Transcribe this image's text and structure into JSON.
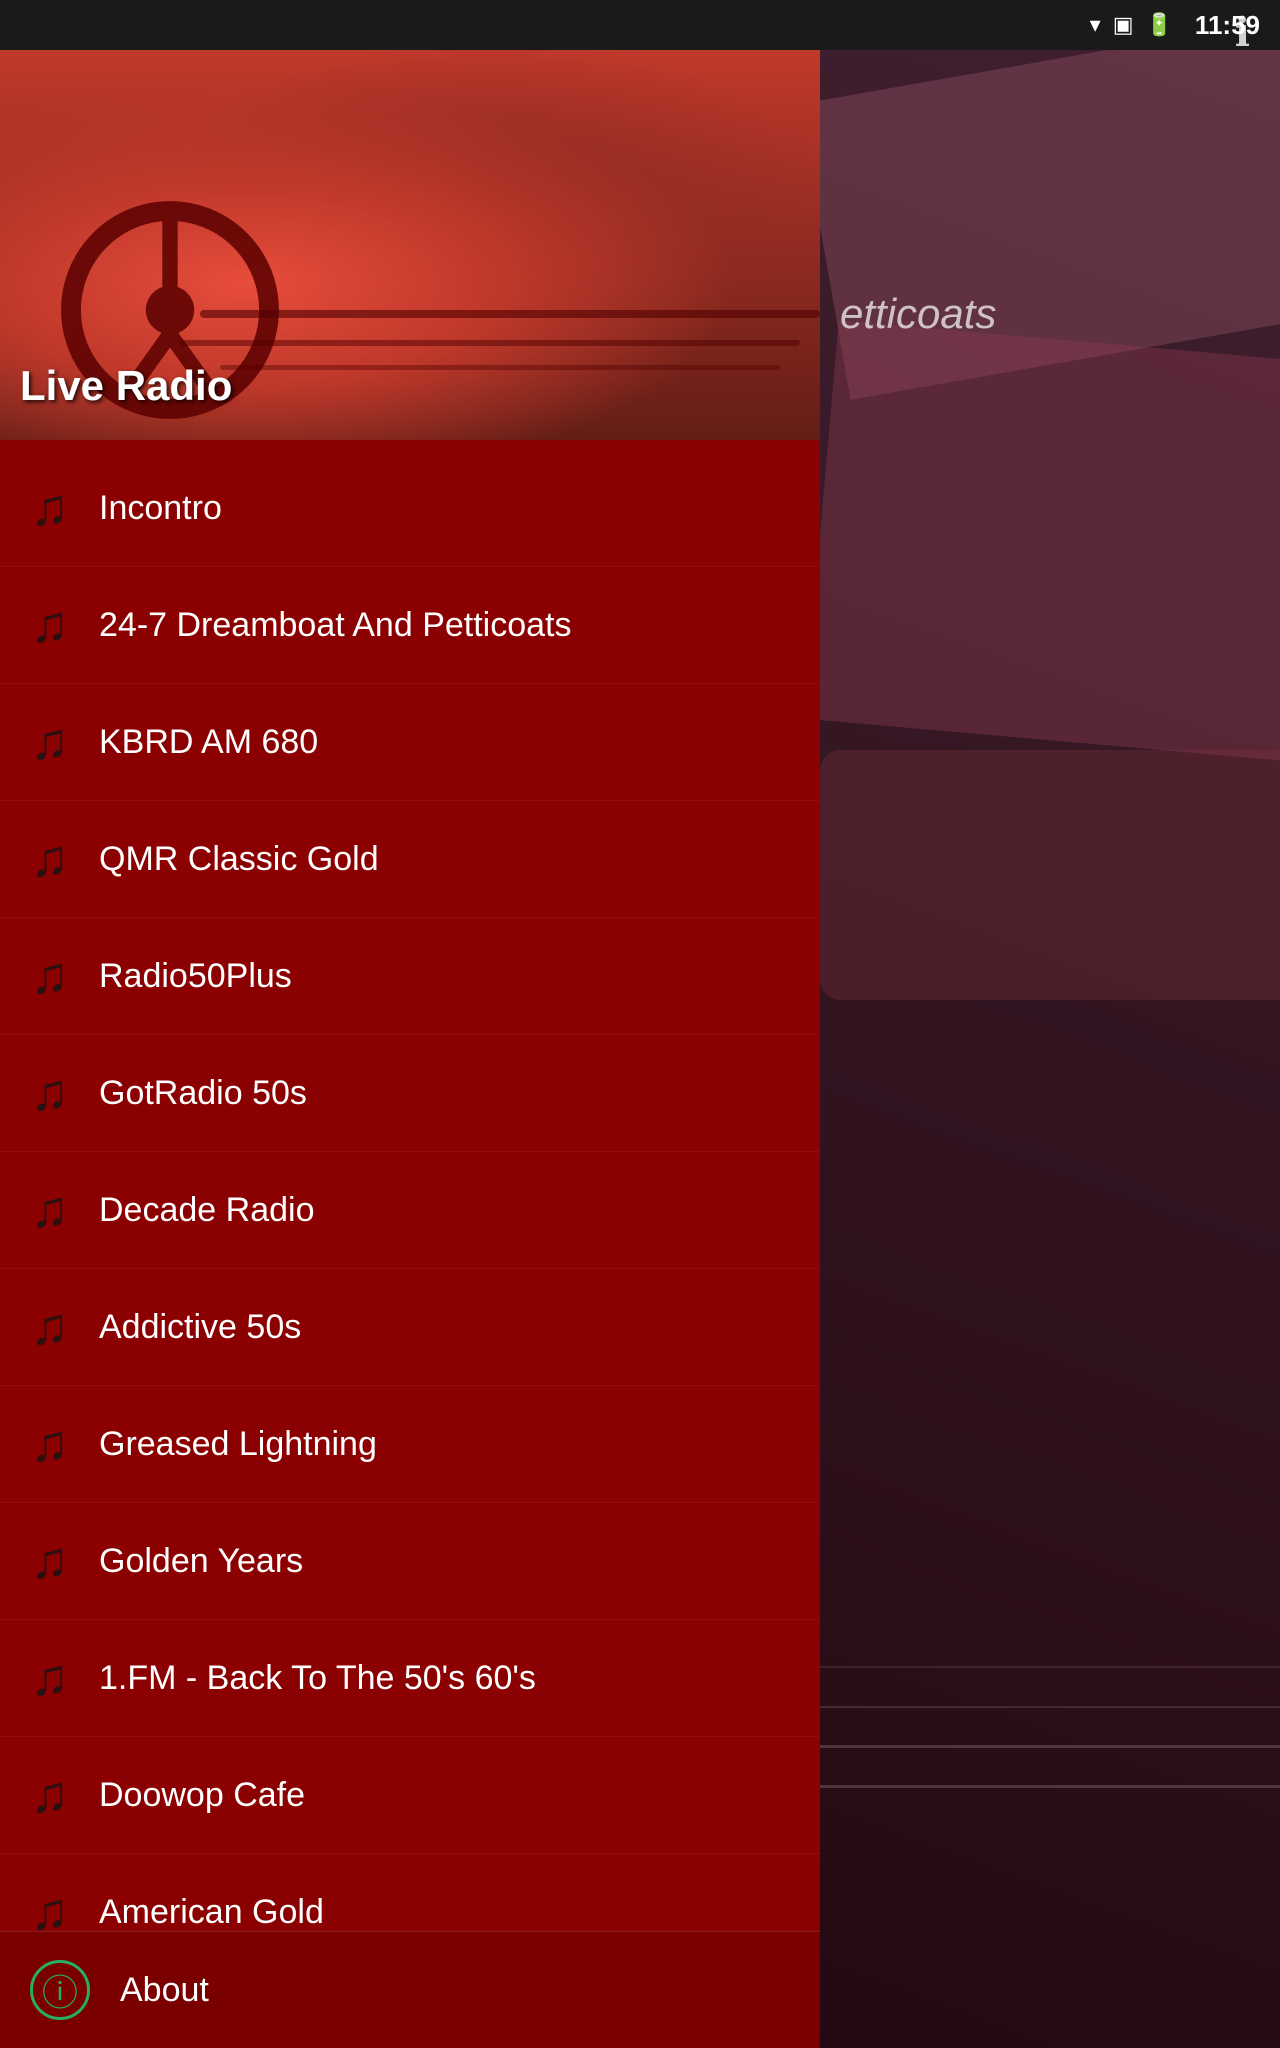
{
  "statusBar": {
    "time": "11:59",
    "icons": [
      "wifi",
      "sim",
      "battery"
    ]
  },
  "header": {
    "title": "Live Radio",
    "imageAlt": "Classic red car dashboard"
  },
  "infoButton": {
    "label": "ℹ"
  },
  "nowPlaying": {
    "text": "etticoats"
  },
  "menuItems": [
    {
      "id": 1,
      "label": "Incontro"
    },
    {
      "id": 2,
      "label": "24-7 Dreamboat And Petticoats"
    },
    {
      "id": 3,
      "label": "KBRD AM 680"
    },
    {
      "id": 4,
      "label": "QMR Classic Gold"
    },
    {
      "id": 5,
      "label": "Radio50Plus"
    },
    {
      "id": 6,
      "label": "GotRadio 50s"
    },
    {
      "id": 7,
      "label": "Decade Radio"
    },
    {
      "id": 8,
      "label": "Addictive 50s"
    },
    {
      "id": 9,
      "label": "Greased Lightning"
    },
    {
      "id": 10,
      "label": "Golden Years"
    },
    {
      "id": 11,
      "label": "1.FM - Back To The 50's 60's"
    },
    {
      "id": 12,
      "label": "Doowop Cafe"
    },
    {
      "id": 13,
      "label": "American Gold"
    }
  ],
  "aboutItem": {
    "label": "About"
  },
  "colors": {
    "sidebarBg": "#8b0000",
    "aboutBg": "#7a0000",
    "iconColor": "#2c1010",
    "aboutIconColor": "#27ae60"
  },
  "musicIconSymbol": "♪",
  "aboutIconSymbol": "ⓘ"
}
